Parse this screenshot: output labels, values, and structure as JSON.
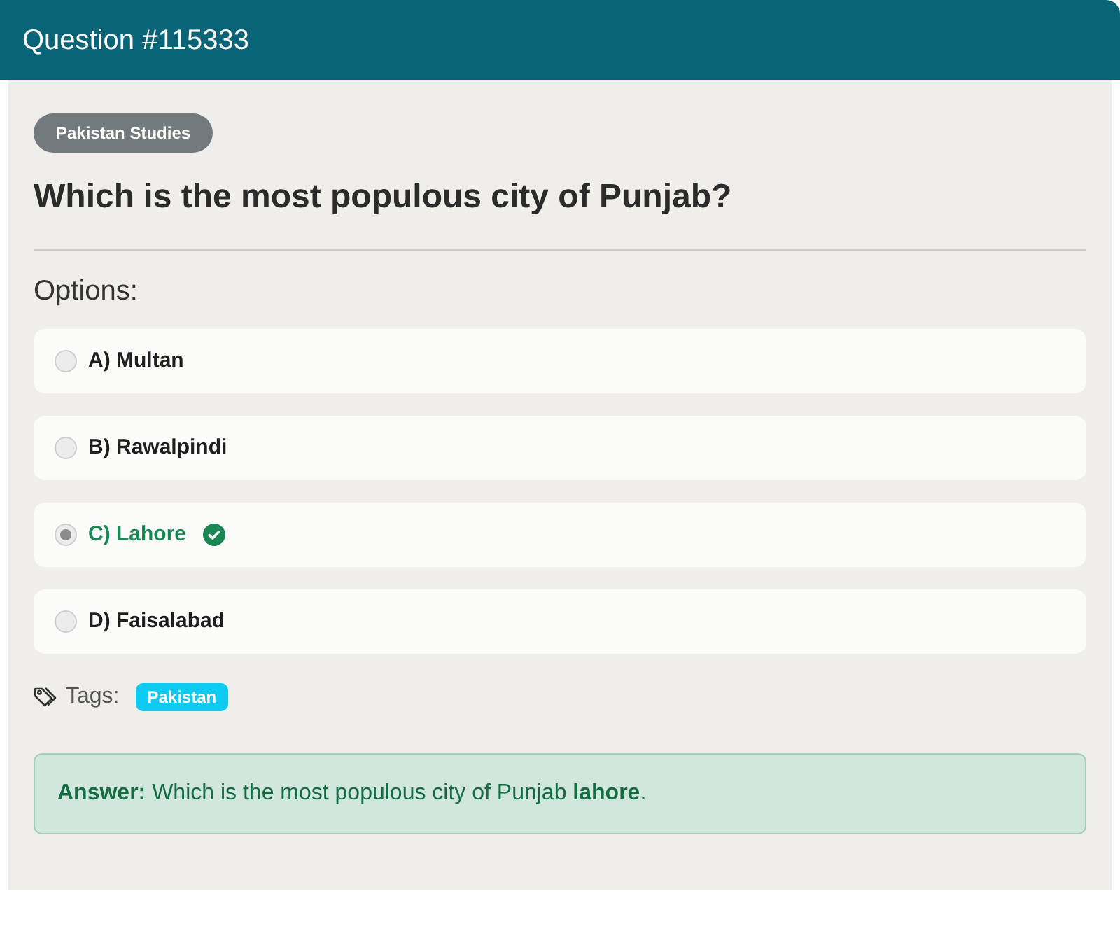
{
  "header": {
    "title": "Question #115333"
  },
  "category": "Pakistan Studies",
  "question": "Which is the most populous city of Punjab?",
  "options_label": "Options:",
  "options": [
    {
      "label": "A) Multan",
      "selected": false,
      "correct": false
    },
    {
      "label": "B) Rawalpindi",
      "selected": false,
      "correct": false
    },
    {
      "label": "C) Lahore",
      "selected": true,
      "correct": true
    },
    {
      "label": "D) Faisalabad",
      "selected": false,
      "correct": false
    }
  ],
  "tags_label": "Tags:",
  "tags": [
    "Pakistan"
  ],
  "answer": "**Answer:** Which is the most populous city of Punjab **lahore**."
}
